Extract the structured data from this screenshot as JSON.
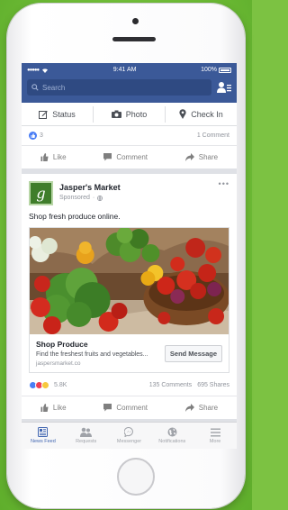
{
  "colors": {
    "brand": "#3b5998",
    "background": "#7cc242",
    "like": "#4a7ef5"
  },
  "status_bar": {
    "time": "9:41 AM",
    "battery": "100%",
    "signal_icon": "signal-dots-icon",
    "wifi_icon": "wifi-icon"
  },
  "search": {
    "placeholder": "Search"
  },
  "composer": {
    "status_label": "Status",
    "photo_label": "Photo",
    "checkin_label": "Check In"
  },
  "top_post": {
    "likes": "3",
    "comments": "1 Comment",
    "like_label": "Like",
    "comment_label": "Comment",
    "share_label": "Share"
  },
  "ad_post": {
    "page_name": "Jasper's Market",
    "logo_letter": "g",
    "sponsored": "Sponsored",
    "text": "Shop fresh produce online.",
    "ad_title": "Shop Produce",
    "ad_description": "Find the freshest fruits and vegetables...",
    "ad_url": "jaspersmarket.co",
    "cta_label": "Send Message",
    "reactions": "5.8K",
    "comments": "135 Comments",
    "shares": "695 Shares",
    "like_label": "Like",
    "comment_label": "Comment",
    "share_label": "Share"
  },
  "tabs": [
    {
      "label": "News Feed",
      "icon": "news-feed-icon",
      "active": true
    },
    {
      "label": "Requests",
      "icon": "friend-requests-icon",
      "active": false
    },
    {
      "label": "Messenger",
      "icon": "messenger-icon",
      "active": false
    },
    {
      "label": "Notifications",
      "icon": "globe-icon",
      "active": false
    },
    {
      "label": "More",
      "icon": "menu-icon",
      "active": false
    }
  ]
}
